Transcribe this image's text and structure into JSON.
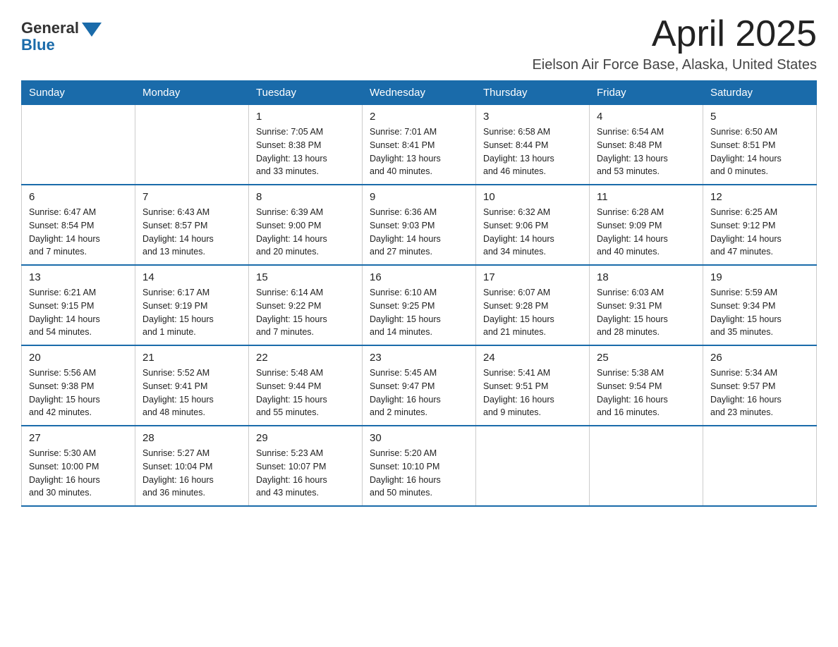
{
  "logo": {
    "text_general": "General",
    "text_blue": "Blue"
  },
  "header": {
    "month": "April 2025",
    "location": "Eielson Air Force Base, Alaska, United States"
  },
  "weekdays": [
    "Sunday",
    "Monday",
    "Tuesday",
    "Wednesday",
    "Thursday",
    "Friday",
    "Saturday"
  ],
  "weeks": [
    [
      {
        "day": "",
        "info": ""
      },
      {
        "day": "",
        "info": ""
      },
      {
        "day": "1",
        "info": "Sunrise: 7:05 AM\nSunset: 8:38 PM\nDaylight: 13 hours\nand 33 minutes."
      },
      {
        "day": "2",
        "info": "Sunrise: 7:01 AM\nSunset: 8:41 PM\nDaylight: 13 hours\nand 40 minutes."
      },
      {
        "day": "3",
        "info": "Sunrise: 6:58 AM\nSunset: 8:44 PM\nDaylight: 13 hours\nand 46 minutes."
      },
      {
        "day": "4",
        "info": "Sunrise: 6:54 AM\nSunset: 8:48 PM\nDaylight: 13 hours\nand 53 minutes."
      },
      {
        "day": "5",
        "info": "Sunrise: 6:50 AM\nSunset: 8:51 PM\nDaylight: 14 hours\nand 0 minutes."
      }
    ],
    [
      {
        "day": "6",
        "info": "Sunrise: 6:47 AM\nSunset: 8:54 PM\nDaylight: 14 hours\nand 7 minutes."
      },
      {
        "day": "7",
        "info": "Sunrise: 6:43 AM\nSunset: 8:57 PM\nDaylight: 14 hours\nand 13 minutes."
      },
      {
        "day": "8",
        "info": "Sunrise: 6:39 AM\nSunset: 9:00 PM\nDaylight: 14 hours\nand 20 minutes."
      },
      {
        "day": "9",
        "info": "Sunrise: 6:36 AM\nSunset: 9:03 PM\nDaylight: 14 hours\nand 27 minutes."
      },
      {
        "day": "10",
        "info": "Sunrise: 6:32 AM\nSunset: 9:06 PM\nDaylight: 14 hours\nand 34 minutes."
      },
      {
        "day": "11",
        "info": "Sunrise: 6:28 AM\nSunset: 9:09 PM\nDaylight: 14 hours\nand 40 minutes."
      },
      {
        "day": "12",
        "info": "Sunrise: 6:25 AM\nSunset: 9:12 PM\nDaylight: 14 hours\nand 47 minutes."
      }
    ],
    [
      {
        "day": "13",
        "info": "Sunrise: 6:21 AM\nSunset: 9:15 PM\nDaylight: 14 hours\nand 54 minutes."
      },
      {
        "day": "14",
        "info": "Sunrise: 6:17 AM\nSunset: 9:19 PM\nDaylight: 15 hours\nand 1 minute."
      },
      {
        "day": "15",
        "info": "Sunrise: 6:14 AM\nSunset: 9:22 PM\nDaylight: 15 hours\nand 7 minutes."
      },
      {
        "day": "16",
        "info": "Sunrise: 6:10 AM\nSunset: 9:25 PM\nDaylight: 15 hours\nand 14 minutes."
      },
      {
        "day": "17",
        "info": "Sunrise: 6:07 AM\nSunset: 9:28 PM\nDaylight: 15 hours\nand 21 minutes."
      },
      {
        "day": "18",
        "info": "Sunrise: 6:03 AM\nSunset: 9:31 PM\nDaylight: 15 hours\nand 28 minutes."
      },
      {
        "day": "19",
        "info": "Sunrise: 5:59 AM\nSunset: 9:34 PM\nDaylight: 15 hours\nand 35 minutes."
      }
    ],
    [
      {
        "day": "20",
        "info": "Sunrise: 5:56 AM\nSunset: 9:38 PM\nDaylight: 15 hours\nand 42 minutes."
      },
      {
        "day": "21",
        "info": "Sunrise: 5:52 AM\nSunset: 9:41 PM\nDaylight: 15 hours\nand 48 minutes."
      },
      {
        "day": "22",
        "info": "Sunrise: 5:48 AM\nSunset: 9:44 PM\nDaylight: 15 hours\nand 55 minutes."
      },
      {
        "day": "23",
        "info": "Sunrise: 5:45 AM\nSunset: 9:47 PM\nDaylight: 16 hours\nand 2 minutes."
      },
      {
        "day": "24",
        "info": "Sunrise: 5:41 AM\nSunset: 9:51 PM\nDaylight: 16 hours\nand 9 minutes."
      },
      {
        "day": "25",
        "info": "Sunrise: 5:38 AM\nSunset: 9:54 PM\nDaylight: 16 hours\nand 16 minutes."
      },
      {
        "day": "26",
        "info": "Sunrise: 5:34 AM\nSunset: 9:57 PM\nDaylight: 16 hours\nand 23 minutes."
      }
    ],
    [
      {
        "day": "27",
        "info": "Sunrise: 5:30 AM\nSunset: 10:00 PM\nDaylight: 16 hours\nand 30 minutes."
      },
      {
        "day": "28",
        "info": "Sunrise: 5:27 AM\nSunset: 10:04 PM\nDaylight: 16 hours\nand 36 minutes."
      },
      {
        "day": "29",
        "info": "Sunrise: 5:23 AM\nSunset: 10:07 PM\nDaylight: 16 hours\nand 43 minutes."
      },
      {
        "day": "30",
        "info": "Sunrise: 5:20 AM\nSunset: 10:10 PM\nDaylight: 16 hours\nand 50 minutes."
      },
      {
        "day": "",
        "info": ""
      },
      {
        "day": "",
        "info": ""
      },
      {
        "day": "",
        "info": ""
      }
    ]
  ]
}
